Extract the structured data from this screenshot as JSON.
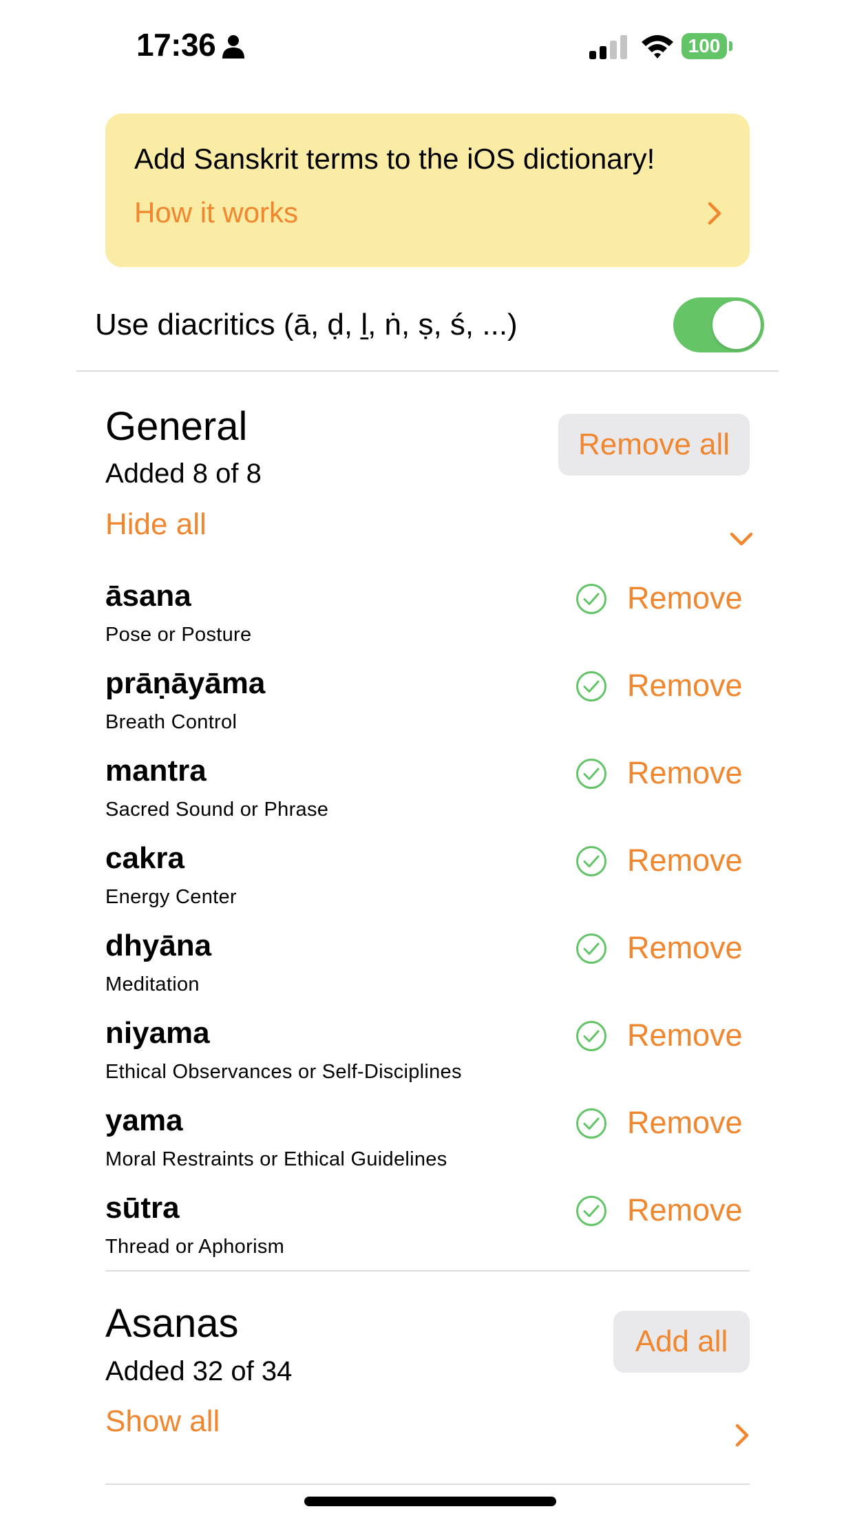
{
  "status_bar": {
    "time": "17:36",
    "battery": "100"
  },
  "banner": {
    "title": "Add Sanskrit terms to the iOS dictionary!",
    "link_label": "How it works"
  },
  "settings": {
    "diacritics_label": "Use diacritics (ā, ḍ, ḻ, ṅ, ṣ, ś, ...)",
    "diacritics_enabled": true
  },
  "sections": [
    {
      "title": "General",
      "count": "Added 8 of 8",
      "toggle_label": "Hide all",
      "action_label": "Remove all",
      "expanded": true,
      "terms": [
        {
          "name": "āsana",
          "meaning": "Pose or Posture",
          "action": "Remove"
        },
        {
          "name": "prāṇāyāma",
          "meaning": "Breath Control",
          "action": "Remove"
        },
        {
          "name": "mantra",
          "meaning": "Sacred Sound or Phrase",
          "action": "Remove"
        },
        {
          "name": "cakra",
          "meaning": "Energy Center",
          "action": "Remove"
        },
        {
          "name": "dhyāna",
          "meaning": "Meditation",
          "action": "Remove"
        },
        {
          "name": "niyama",
          "meaning": "Ethical Observances or Self-Disciplines",
          "action": "Remove"
        },
        {
          "name": "yama",
          "meaning": "Moral Restraints or Ethical Guidelines",
          "action": "Remove"
        },
        {
          "name": "sūtra",
          "meaning": "Thread or Aphorism",
          "action": "Remove"
        }
      ]
    },
    {
      "title": "Asanas",
      "count": "Added 32 of 34",
      "toggle_label": "Show all",
      "action_label": "Add all",
      "expanded": false
    }
  ],
  "colors": {
    "accent": "#f0862e",
    "banner_bg": "#fbeca5",
    "toggle_on": "#65c466",
    "check": "#62c466",
    "pill_bg": "#e9e9eb"
  },
  "icons": {
    "person": "person-icon",
    "signal": "cellular-signal-icon",
    "wifi": "wifi-icon",
    "chevron_right": "chevron-right-icon",
    "chevron_down": "chevron-down-icon",
    "check": "checkmark-circle-icon"
  }
}
